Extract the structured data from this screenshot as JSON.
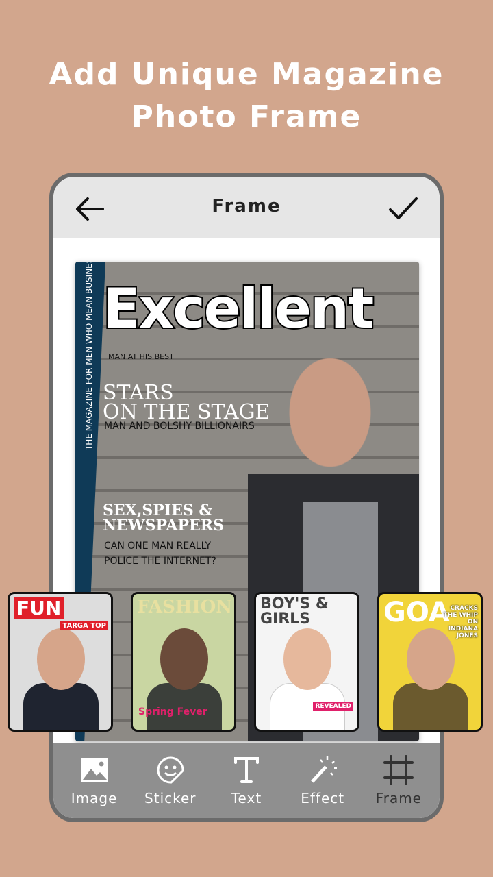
{
  "headline": {
    "line1": "Add Unique Magazine",
    "line2": "Photo Frame"
  },
  "header": {
    "title": "Frame",
    "back_icon": "arrow-left-icon",
    "confirm_icon": "check-icon"
  },
  "magazine": {
    "title": "Excellent",
    "spine": "THE MAGAZINE FOR MEN WHO MEAN BUSINESS",
    "tagline": "MAN AT HIS BEST",
    "headline1_line1": "STARS",
    "headline1_line2": "ON THE STAGE",
    "sub1": "MAN AND BOLSHY BILLIONAIRS",
    "headline2_line1": "SEX,SPIES &",
    "headline2_line2": "NEWSPAPERS",
    "sub2_line1": "CAN ONE MAN REALLY",
    "sub2_line2": "POLICE THE INTERNET?"
  },
  "frames": [
    {
      "title": "FUN",
      "subtitle": "TARGA TOP",
      "bg": "#f2f2f2",
      "accent": "#e0202a"
    },
    {
      "title": "FASHION",
      "subtitle": "Spring Fever",
      "bg": "#c9d6a2",
      "accent": "#e0206a"
    },
    {
      "title": "BOY'S & GIRLS",
      "subtitle": "REVEALED",
      "bg": "#f4f4f4",
      "accent": "#e0206a"
    },
    {
      "title": "GOA",
      "subtitle": "CRACKS THE WHIP ON INDIANA JONES",
      "bg": "#f1d43a",
      "accent": "#ffffff"
    }
  ],
  "toolbar": {
    "items": [
      {
        "label": "Image",
        "icon": "image-icon"
      },
      {
        "label": "Sticker",
        "icon": "sticker-icon"
      },
      {
        "label": "Text",
        "icon": "text-icon"
      },
      {
        "label": "Effect",
        "icon": "magic-wand-icon"
      },
      {
        "label": "Frame",
        "icon": "crop-frame-icon",
        "active": true
      }
    ]
  }
}
